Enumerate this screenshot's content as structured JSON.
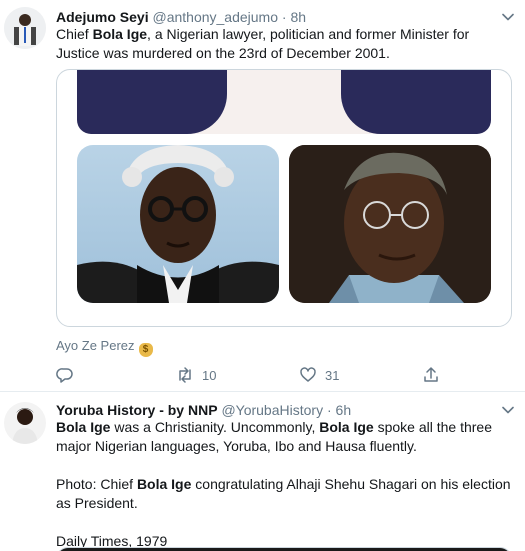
{
  "tweets": [
    {
      "author": {
        "name": "Adejumo Seyi",
        "handle": "@anthony_adejumo",
        "separator": "·",
        "time": "8h"
      },
      "text": {
        "t1": "Chief ",
        "b1": "Bola Ige",
        "t2": ", a Nigerian lawyer, politician and former Minister for Justice was murdered on the 23rd of December 2001."
      },
      "attribution": "Ayo Ze Perez",
      "attribution_emoji": "money-bag",
      "actions": {
        "replies": "",
        "retweets": "10",
        "likes": "31"
      }
    },
    {
      "author": {
        "name": "Yoruba History - by NNP",
        "handle": "@YorubaHistory",
        "separator": "·",
        "time": "6h"
      },
      "text": {
        "b1": "Bola Ige",
        "t1": " was a Christianity. Uncommonly, ",
        "b2": "Bola Ige",
        "t2": " spoke all the three major Nigerian languages, Yoruba, Ibo and Hausa fluently.",
        "p2_t1": "Photo: Chief ",
        "p2_b1": "Bola Ige",
        "p2_t2": " congratulating Alhaji Shehu Shagari on his election as President.",
        "p3": "Daily Times, 1979"
      }
    }
  ],
  "colors": {
    "text_primary": "#14171a",
    "text_secondary": "#657786",
    "border": "#e6ecf0"
  },
  "icons": [
    "chevron-down-icon",
    "reply-icon",
    "retweet-icon",
    "like-icon",
    "share-icon",
    "money-bag-icon"
  ]
}
